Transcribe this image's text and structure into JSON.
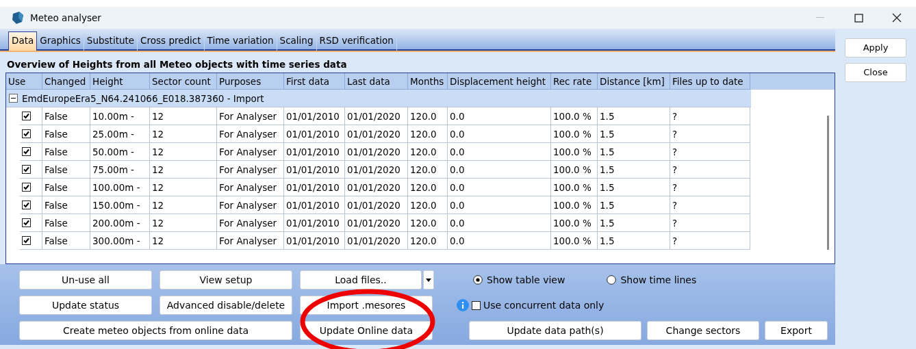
{
  "window": {
    "title": "Meteo analyser"
  },
  "tabs": [
    {
      "label": "Data",
      "selected": true
    },
    {
      "label": "Graphics",
      "selected": false
    },
    {
      "label": "Substitute",
      "selected": false
    },
    {
      "label": "Cross predict",
      "selected": false
    },
    {
      "label": "Time variation",
      "selected": false
    },
    {
      "label": "Scaling",
      "selected": false
    },
    {
      "label": "RSD verification",
      "selected": false
    }
  ],
  "side_buttons": [
    "Apply",
    "Close"
  ],
  "heading": "Overview of Heights from all Meteo objects with time series data",
  "table": {
    "columns": [
      "Use",
      "Changed",
      "Height",
      "Sector count",
      "Purposes",
      "First data",
      "Last data",
      "Months",
      "Displacement height",
      "Rec rate",
      "Distance [km]",
      "Files up to date"
    ],
    "groups": [
      {
        "name": "EmdEuropeEra5_N64.241066_E018.387360 - Import",
        "expanded": true,
        "rows": [
          {
            "use": true,
            "cells": [
              "False",
              "10.00m -",
              "12",
              "For Analyser",
              "01/01/2010",
              "01/01/2020",
              "120.0",
              "0.0",
              "100.0 %",
              "1.5",
              "?"
            ]
          },
          {
            "use": true,
            "cells": [
              "False",
              "25.00m -",
              "12",
              "For Analyser",
              "01/01/2010",
              "01/01/2020",
              "120.0",
              "0.0",
              "100.0 %",
              "1.5",
              "?"
            ]
          },
          {
            "use": true,
            "cells": [
              "False",
              "50.00m -",
              "12",
              "For Analyser",
              "01/01/2010",
              "01/01/2020",
              "120.0",
              "0.0",
              "100.0 %",
              "1.5",
              "?"
            ]
          },
          {
            "use": true,
            "cells": [
              "False",
              "75.00m -",
              "12",
              "For Analyser",
              "01/01/2010",
              "01/01/2020",
              "120.0",
              "0.0",
              "100.0 %",
              "1.5",
              "?"
            ]
          },
          {
            "use": true,
            "cells": [
              "False",
              "100.00m -",
              "12",
              "For Analyser",
              "01/01/2010",
              "01/01/2020",
              "120.0",
              "0.0",
              "100.0 %",
              "1.5",
              "?"
            ]
          },
          {
            "use": true,
            "cells": [
              "False",
              "150.00m -",
              "12",
              "For Analyser",
              "01/01/2010",
              "01/01/2020",
              "120.0",
              "0.0",
              "100.0 %",
              "1.5",
              "?"
            ]
          },
          {
            "use": true,
            "cells": [
              "False",
              "200.00m -",
              "12",
              "For Analyser",
              "01/01/2010",
              "01/01/2020",
              "120.0",
              "0.0",
              "100.0 %",
              "1.5",
              "?"
            ]
          },
          {
            "use": true,
            "cells": [
              "False",
              "300.00m -",
              "12",
              "For Analyser",
              "01/01/2010",
              "01/01/2020",
              "120.0",
              "0.0",
              "100.0 %",
              "1.5",
              "?"
            ]
          }
        ]
      }
    ]
  },
  "action_rows": [
    [
      {
        "label": "Un-use all",
        "kind": "button"
      },
      {
        "label": "View setup",
        "kind": "button"
      },
      {
        "label": "Load files..",
        "kind": "split"
      }
    ],
    [
      {
        "label": "Update status",
        "kind": "button"
      },
      {
        "label": "Advanced disable/delete",
        "kind": "button"
      },
      {
        "label": "Import .mesores",
        "kind": "button"
      }
    ],
    [
      {
        "label": "Create meteo objects from online data",
        "kind": "wide"
      },
      {
        "label": "Update Online data",
        "kind": "button"
      }
    ]
  ],
  "view_options": [
    {
      "label": "Show table view",
      "selected": true
    },
    {
      "label": "Show time lines",
      "selected": false
    }
  ],
  "concurrent": {
    "label": "Use concurrent data only",
    "checked": false
  },
  "right_buttons": [
    "Update data path(s)",
    "Change sectors",
    "Export"
  ]
}
